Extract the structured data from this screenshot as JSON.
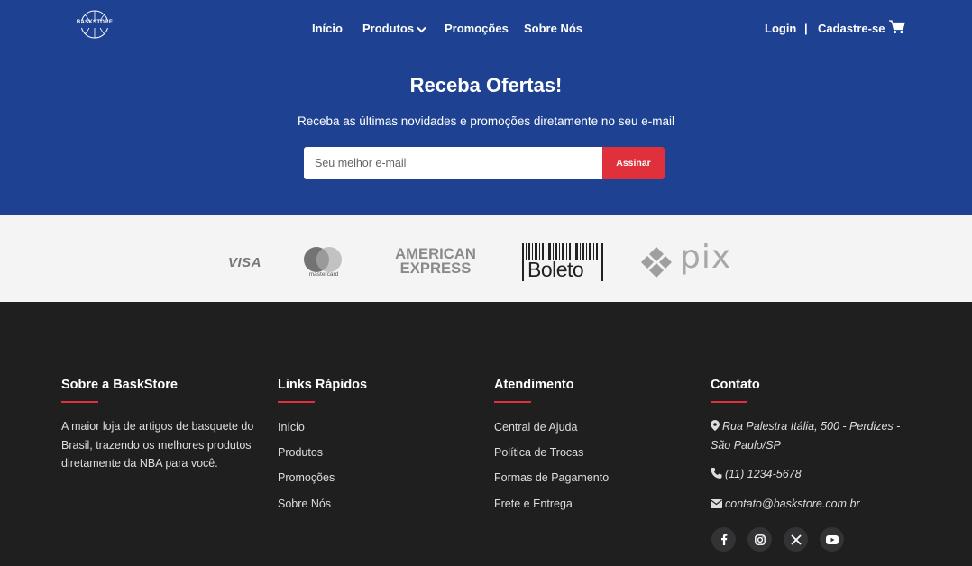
{
  "nav": {
    "logo_text": "BASKSTORE",
    "menu": [
      "Início",
      "Produtos",
      "Promoções",
      "Sobre Nós"
    ],
    "login": "Login",
    "separator": "|",
    "signup": "Cadastre-se"
  },
  "newsletter": {
    "title": "Receba Ofertas!",
    "subtitle": "Receba as últimas novidades e promoções diretamente no seu e-mail",
    "placeholder": "Seu melhor e-mail",
    "button": "Assinar"
  },
  "payments": {
    "visa": "VISA",
    "mastercard": "mastercard",
    "amex_line1": "AMERICAN",
    "amex_line2": "EXPRESS",
    "boleto": "Boleto",
    "pix": "pix"
  },
  "footer": {
    "about": {
      "title": "Sobre a BaskStore",
      "text": "A maior loja de artigos de basquete do Brasil, trazendo os melhores produtos diretamente da NBA para você."
    },
    "links": {
      "title": "Links Rápidos",
      "items": [
        "Início",
        "Produtos",
        "Promoções",
        "Sobre Nós"
      ]
    },
    "support": {
      "title": "Atendimento",
      "items": [
        "Central de Ajuda",
        "Política de Trocas",
        "Formas de Pagamento",
        "Frete e Entrega"
      ]
    },
    "contact": {
      "title": "Contato",
      "address": "Rua Palestra Itália, 500 - Perdizes - São Paulo/SP",
      "phone": "(11) 1234-5678",
      "email": "contato@baskstore.com.br"
    },
    "social_icons": [
      "facebook-icon",
      "instagram-icon",
      "x-icon",
      "youtube-icon"
    ]
  },
  "colors": {
    "primary_blue": "#1e4291",
    "accent_red": "#e0303c",
    "footer_bg": "#1f1f20"
  }
}
